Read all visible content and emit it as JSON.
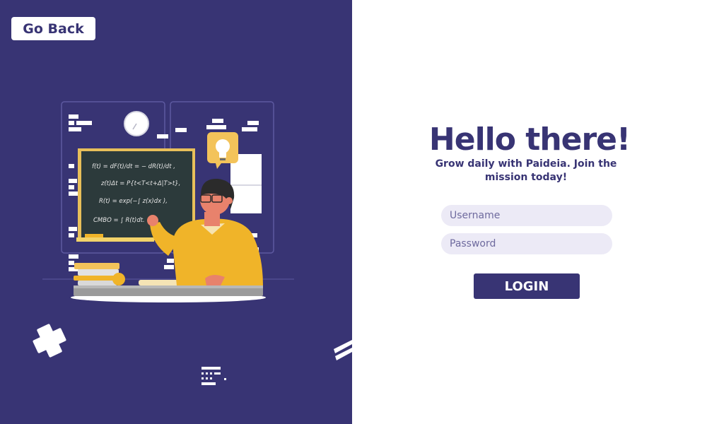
{
  "nav": {
    "go_back_label": "Go Back"
  },
  "hero": {
    "title": "Hello there!",
    "subtitle": "Grow daily with Paideia. Join the mission today!"
  },
  "form": {
    "username_placeholder": "Username",
    "password_placeholder": "Password",
    "login_label": "LOGIN"
  },
  "illustration": {
    "formulas": [
      "f(t) = dF(t)/dt = − dR(t)/dt ,",
      "z(t)Δt = P{t<T<t+Δ|T>t},",
      "R(t) = exp(−∫ z(x)dx ),",
      "CMBO = ∫ R(t)dt."
    ]
  },
  "colors": {
    "brand": "#383474",
    "field_bg": "#eceaf6",
    "accent_yellow": "#f0b429",
    "white": "#ffffff"
  },
  "icons": [
    "teacher-illustration",
    "lightbulb-icon",
    "clock-icon",
    "plus-icon",
    "logo-mark-icon"
  ]
}
